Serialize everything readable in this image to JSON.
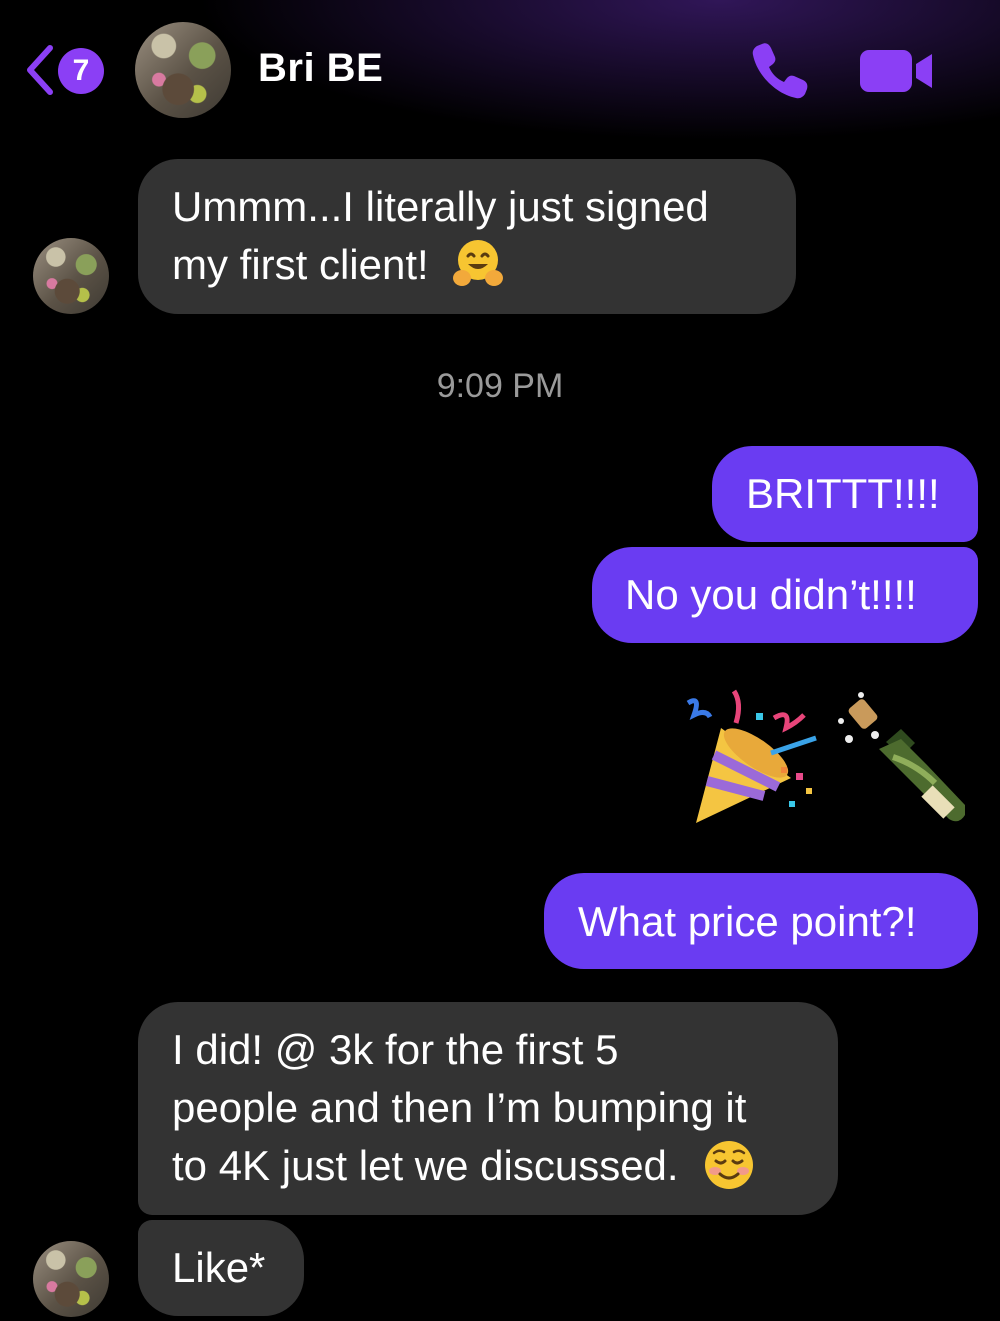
{
  "header": {
    "back_badge_count": "7",
    "contact_name": "Bri BE"
  },
  "colors": {
    "accent": "#8b3ff5",
    "outgoing_bubble": "#6a3cf2",
    "incoming_bubble": "#333333",
    "timestamp": "#9a9a9a"
  },
  "messages": {
    "m1_line1": "Ummm...I literally just signed",
    "m1_line2": "my first client!",
    "timestamp": "9:09 PM",
    "m2": "BRITTT!!!!",
    "m3": "No you didn’t!!!!",
    "m4_emoji": [
      "party-popper-icon",
      "champagne-bottle-icon"
    ],
    "m5": "What price point?!",
    "m6_line1": "I did! @ 3k for the first 5",
    "m6_line2": "people and then I’m bumping it",
    "m6_line3": "to 4K just let we discussed.",
    "m7": "Like*"
  }
}
